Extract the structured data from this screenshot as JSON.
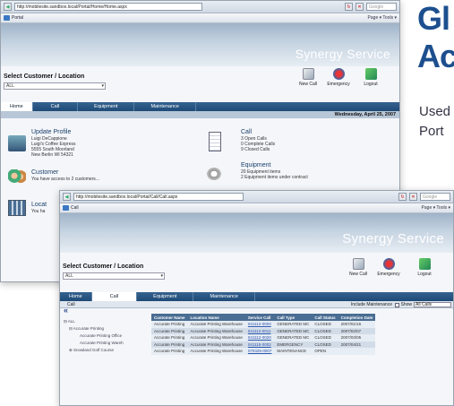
{
  "background_doc": {
    "heading_line1": "Gl",
    "heading_line2": "Ac",
    "text_line1": "Used",
    "text_line2": "Port"
  },
  "window1": {
    "address": "http://mobilesite.sandbox.local/Portal/Home/Home.aspx",
    "search_placeholder": "Google",
    "tab_title": "Portal",
    "tools": "Page ▾  Tools ▾",
    "brand": "Synergy Service",
    "select_label": "Select Customer / Location",
    "select_value": "ALL",
    "actions": [
      "New Call",
      "Emergency",
      "Logout"
    ],
    "nav": [
      "Home",
      "Call",
      "Equipment",
      "Maintenance"
    ],
    "active_nav": "Home",
    "date": "Wednesday, April 25, 2007",
    "profile": {
      "title": "Update Profile",
      "lines": [
        "Luigi DeCappione",
        "Luigi's Coffee Express",
        "5555 South Moorland",
        "New Berlin WI 54321"
      ]
    },
    "customer": {
      "title": "Customer",
      "line": "You have access to 2 customers..."
    },
    "location": {
      "title": "Locat",
      "line": "You ha"
    },
    "call": {
      "title": "Call",
      "lines": [
        "3  Open Calls",
        "0  Complete Calls",
        "9  Closed Calls"
      ]
    },
    "equipment": {
      "title": "Equipment",
      "lines": [
        "20  Equipment items",
        "2  Equipment items under contract"
      ]
    }
  },
  "window2": {
    "address": "http://mobilesite.sandbox.local/Portal/Call/Call.aspx",
    "search_placeholder": "Google",
    "tab_title": "Call",
    "tools": "Page ▾  Tools ▾",
    "brand": "Synergy Service",
    "select_label": "Select Customer / Location",
    "select_value": "ALL",
    "actions": [
      "New Call",
      "Emergency",
      "Logout"
    ],
    "nav": [
      "Home",
      "Call",
      "Equipment",
      "Maintenance"
    ],
    "active_nav": "Call",
    "panel_title": "Call",
    "include_label": "Include Maintenance",
    "show_label": "Show",
    "show_value": "All Calls",
    "tree": [
      "ALL",
      "Accurate Printing",
      "Accurate Printing Office",
      "Accurate Printing Wareh",
      "Snowland Golf Course"
    ],
    "table": {
      "headers": [
        "Customer Name",
        "Location Name",
        "Service Call",
        "Call Type",
        "Call Status",
        "Completion Date"
      ],
      "rows": [
        [
          "Accurate Printing",
          "Accurate Printing Warehouse",
          "041112-0003",
          "GENERATED MC",
          "CLOSED",
          "2007/01/16"
        ],
        [
          "Accurate Printing",
          "Accurate Printing Warehouse",
          "041112-0011",
          "GENERATED MC",
          "CLOSED",
          "2007/02/07"
        ],
        [
          "Accurate Printing",
          "Accurate Printing Warehouse",
          "041112-0020",
          "GENERATED MC",
          "CLOSED",
          "2007/03/05"
        ],
        [
          "Accurate Printing",
          "Accurate Printing Warehouse",
          "041115-0002",
          "EMERGENCY",
          "CLOSED",
          "2007/04/21"
        ],
        [
          "Accurate Printing",
          "Accurate Printing Warehouse",
          "070425-0007",
          "MAINTENANCE",
          "OPEN",
          ""
        ]
      ]
    }
  }
}
